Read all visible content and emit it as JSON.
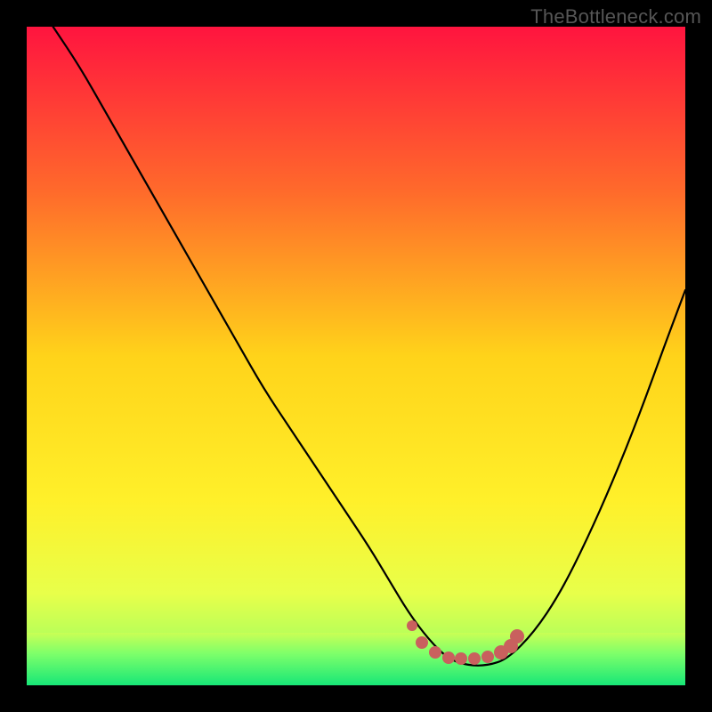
{
  "watermark": "TheBottleneck.com",
  "colors": {
    "background": "#000000",
    "curve_stroke": "#000000",
    "marker_fill": "#c9605e",
    "gradient_stops": [
      {
        "offset": 0.0,
        "color": "#ff143f"
      },
      {
        "offset": 0.25,
        "color": "#ff6a2b"
      },
      {
        "offset": 0.5,
        "color": "#ffd31a"
      },
      {
        "offset": 0.72,
        "color": "#fff02a"
      },
      {
        "offset": 0.86,
        "color": "#e8ff4a"
      },
      {
        "offset": 0.93,
        "color": "#b4ff5a"
      },
      {
        "offset": 1.0,
        "color": "#20e97a"
      }
    ],
    "green_band": {
      "top_pct": 92,
      "height_pct": 8,
      "gradient": [
        {
          "offset": 0.0,
          "color": "#c9ff55"
        },
        {
          "offset": 0.4,
          "color": "#7dff6a"
        },
        {
          "offset": 1.0,
          "color": "#17e777"
        }
      ]
    }
  },
  "chart_data": {
    "type": "line",
    "title": "",
    "xlabel": "",
    "ylabel": "",
    "xlim": [
      0,
      100
    ],
    "ylim": [
      0,
      100
    ],
    "series": [
      {
        "name": "bottleneck-curve",
        "x": [
          4,
          8,
          12,
          16,
          20,
          24,
          28,
          32,
          36,
          40,
          44,
          48,
          52,
          55,
          58,
          61,
          64,
          67,
          70,
          73,
          77,
          81,
          85,
          89,
          93,
          97,
          100
        ],
        "values": [
          100,
          94,
          87,
          80,
          73,
          66,
          59,
          52,
          45,
          39,
          33,
          27,
          21,
          16,
          11,
          7,
          4,
          3,
          3,
          4,
          8,
          14,
          22,
          31,
          41,
          52,
          60
        ]
      }
    ],
    "markers": [
      {
        "x": 58.5,
        "y": 9.0,
        "r": 6
      },
      {
        "x": 60.0,
        "y": 6.5,
        "r": 7
      },
      {
        "x": 62.0,
        "y": 5.0,
        "r": 7
      },
      {
        "x": 64.0,
        "y": 4.2,
        "r": 7
      },
      {
        "x": 66.0,
        "y": 4.0,
        "r": 7
      },
      {
        "x": 68.0,
        "y": 4.0,
        "r": 7
      },
      {
        "x": 70.0,
        "y": 4.3,
        "r": 7
      },
      {
        "x": 72.0,
        "y": 5.0,
        "r": 8
      },
      {
        "x": 73.5,
        "y": 6.0,
        "r": 8
      },
      {
        "x": 74.5,
        "y": 7.5,
        "r": 8
      }
    ],
    "annotations": []
  }
}
